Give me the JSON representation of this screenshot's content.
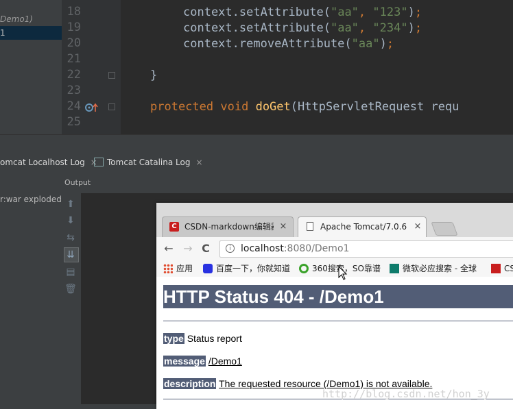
{
  "ide": {
    "project_items": [
      "Demo1)",
      "1"
    ],
    "line_numbers": [
      "18",
      "19",
      "20",
      "21",
      "22",
      "23",
      "24",
      "25"
    ],
    "code": {
      "line18": {
        "obj": "context.",
        "method": "setAttribute",
        "open": "(",
        "arg1": "\"aa\"",
        "sep": ", ",
        "arg2": "\"123\"",
        "close": ")",
        "semi": ";"
      },
      "line19": {
        "obj": "context.",
        "method": "setAttribute",
        "open": "(",
        "arg1": "\"aa\"",
        "sep": ", ",
        "arg2": "\"234\"",
        "close": ")",
        "semi": ";"
      },
      "line20": {
        "obj": "context.",
        "method": "removeAttribute",
        "open": "(",
        "arg1": "\"aa\"",
        "close": ")",
        "semi": ";"
      },
      "line22": "}",
      "line24": {
        "kw1": "protected",
        "kw2": "void",
        "method": "doGet",
        "rest": "(HttpServletRequest requ"
      }
    }
  },
  "tool_window": {
    "tabs": [
      {
        "label": "omcat Localhost Log",
        "close": "×"
      },
      {
        "label": "Tomcat Catalina Log",
        "close": "×"
      }
    ],
    "output_label": "Output",
    "deploy_item": "r:war exploded"
  },
  "browser": {
    "tabs": [
      {
        "title": "CSDN-markdown编辑器",
        "favicon": "C",
        "close": "×"
      },
      {
        "title": "Apache Tomcat/7.0.6 -",
        "close": "×"
      }
    ],
    "nav": {
      "back": "←",
      "forward": "→",
      "reload": "C"
    },
    "url": {
      "host": "localhost",
      "rest": ":8080/Demo1"
    },
    "bookmarks": [
      {
        "label": "应用",
        "icon": "apps-icon"
      },
      {
        "label": "百度一下，你就知道",
        "icon": "baidu-icon"
      },
      {
        "label": "360搜索，SO靠谱",
        "icon": "360-icon"
      },
      {
        "label": "微软必应搜索 - 全球",
        "icon": "bing-icon"
      },
      {
        "label": "CS",
        "icon": "csdn-icon"
      }
    ],
    "page": {
      "title": "HTTP Status 404 - /Demo1",
      "type_key": "type",
      "type_val": "Status report",
      "message_key": "message",
      "message_val": "/Demo1",
      "description_key": "description",
      "description_val": "The requested resource (/Demo1) is not available."
    }
  },
  "watermark": "http://blog.csdn.net/hon_3y",
  "colors": {
    "status_header_bg": "#525d76",
    "ide_bg": "#2b2b2b",
    "string": "#6a8759",
    "keyword": "#cc7832",
    "method": "#ffc66d"
  }
}
